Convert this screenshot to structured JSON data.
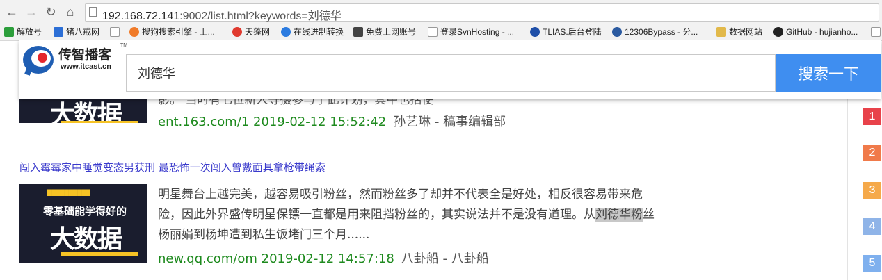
{
  "browser": {
    "url_host": "192.168.72.141",
    "url_rest": ":9002/list.html?keywords=刘德华"
  },
  "bookmarks": [
    {
      "label": "解放号",
      "color": "#2c9e3b"
    },
    {
      "label": "猪八戒网",
      "color": "#2c6fd6"
    },
    {
      "label": "",
      "color": "#cfcfcf"
    },
    {
      "label": "搜狗搜索引擎 - 上...",
      "color": "#f07b2a"
    },
    {
      "label": "天蓬网",
      "color": "#e03a2f"
    },
    {
      "label": "在线进制转换",
      "color": "#2b7be0"
    },
    {
      "label": "免费上网账号",
      "color": "#444444"
    },
    {
      "label": "登录SvnHosting - ...",
      "color": "#cfcfcf"
    },
    {
      "label": "TLIAS.后台登陆",
      "color": "#1f4fa8"
    },
    {
      "label": "12306Bypass - 分...",
      "color": "#2b5aa0"
    },
    {
      "label": "数据网站",
      "color": "#e2b94a"
    },
    {
      "label": "GitHub - hujianho...",
      "color": "#222222"
    }
  ],
  "logo": {
    "name": "传智播客",
    "url": "www.itcast.cn",
    "tm": "TM"
  },
  "search": {
    "value": "刘德华",
    "button": "搜索一下"
  },
  "results": [
    {
      "snippet_partial": "影。  当时有七位新人等摄参与了此计划，其中也括使",
      "source": "ent.163.com/1 2019-02-12 15:52:42",
      "author": "孙艺琳 - 稿事编辑部"
    },
    {
      "title": "闯入霉霉家中睡觉变态男获刑 最恐怖一次闯入曾戴面具拿枪带绳索",
      "snippet_before": "明星舞台上越完美，越容易吸引粉丝，然而粉丝多了却并不代表全是好处，相反很容易带来危险，因此外界盛传明星保镖一直都是用来阻挡粉丝的，其实说法并不是没有道理。从",
      "snippet_highlight": "刘德华粉",
      "snippet_after": "丝杨丽娟到杨坤遭到私生饭堵门三个月......",
      "source": "new.qq.com/om 2019-02-12 14:57:18",
      "author": "八卦船 - 八卦船"
    }
  ],
  "thumb": {
    "big": "大数据",
    "sub": "零基础能学得好的"
  },
  "ranks": [
    {
      "n": "1",
      "color": "#e8424a"
    },
    {
      "n": "2",
      "color": "#f07a4a"
    },
    {
      "n": "3",
      "color": "#f5a94a"
    },
    {
      "n": "4",
      "color": "#8fb4e8"
    },
    {
      "n": "5",
      "color": "#7fb0ee"
    }
  ]
}
